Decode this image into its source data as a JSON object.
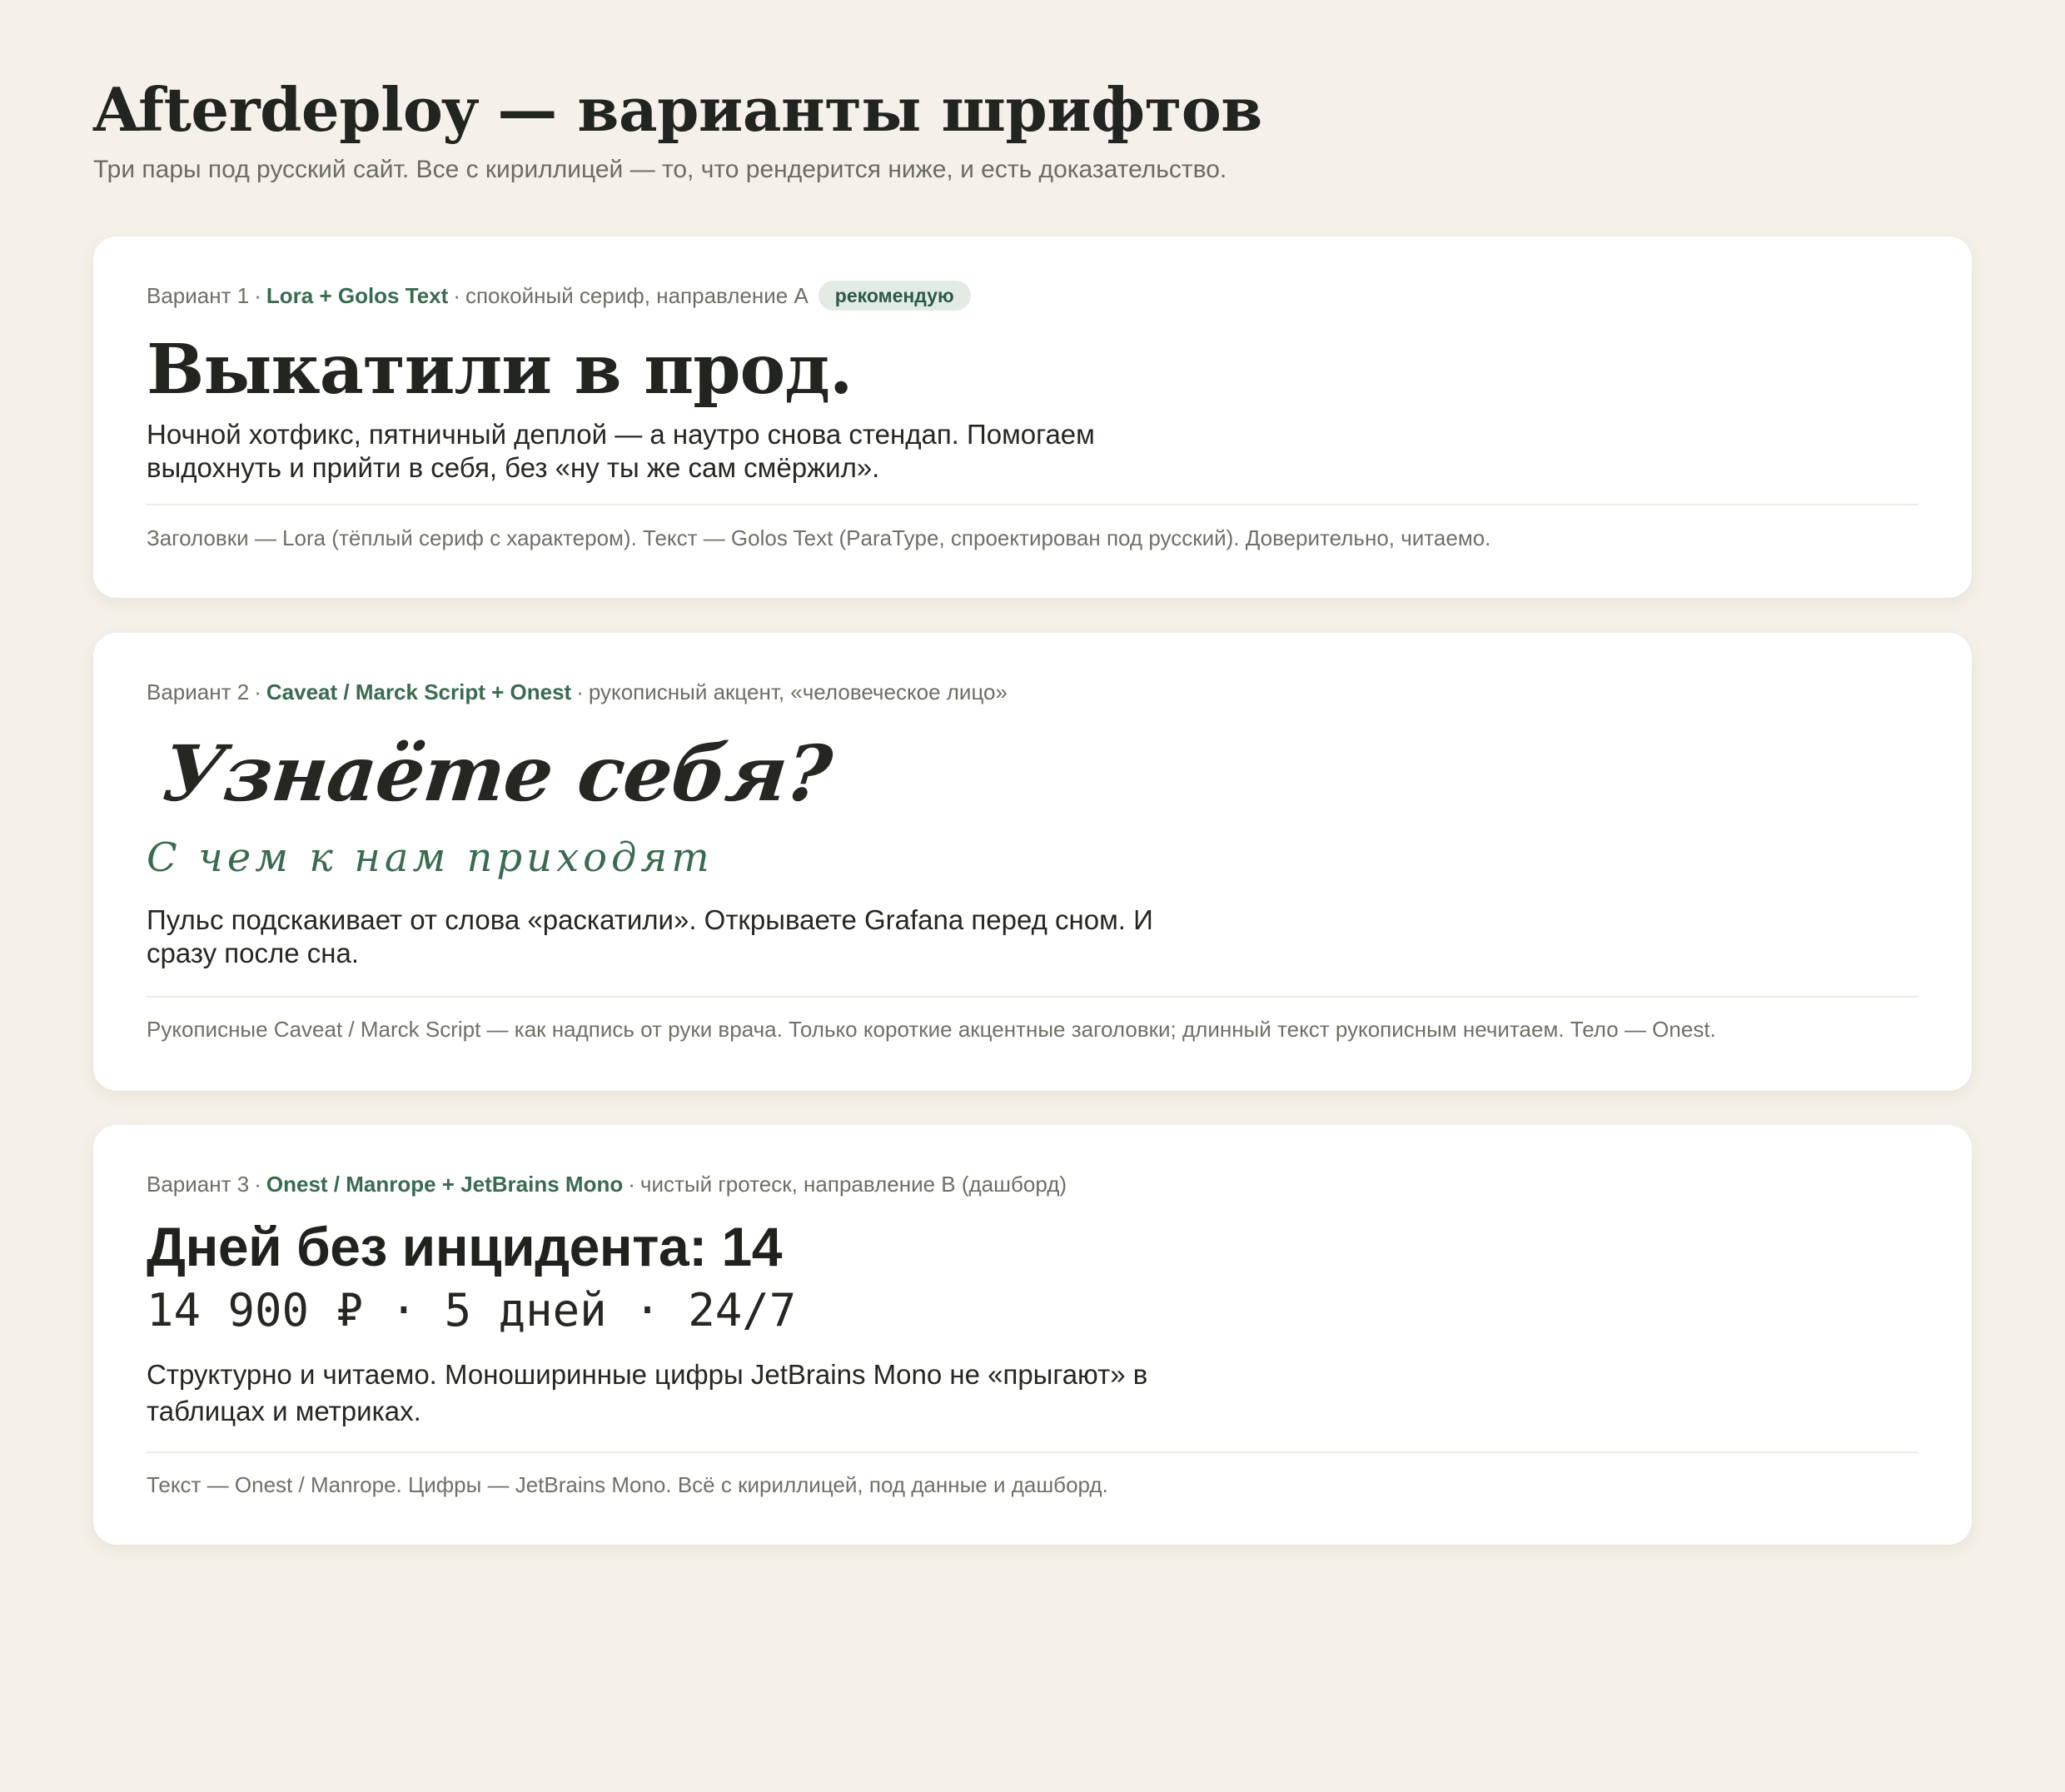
{
  "header": {
    "title": "Afterdeploy — варианты шрифтов",
    "subtitle": "Три пары под русский сайт. Все с кириллицей — то, что рендерится ниже, и есть доказательство."
  },
  "colors": {
    "page_background": "#f5f1ea",
    "card_background": "#ffffff",
    "accent_green": "#3a6b51",
    "badge_background": "#e2ece5",
    "heading_text": "#22251f",
    "muted_text": "#6e6e66"
  },
  "variants": [
    {
      "label": "Вариант 1",
      "fonts": "Lora + Golos Text",
      "description": "спокойный сериф, направление А",
      "badge": "рекомендую",
      "headline": "Выкатили в прод.",
      "body": "Ночной хотфикс, пятничный деплой — а наутро снова стендап. Помогаем выдохнуть и прийти в себя, без «ну ты же сам смёржил».",
      "note": "Заголовки — Lora (тёплый сериф с характером). Текст — Golos Text (ParaType, спроектирован под русский). Доверительно, читаемо."
    },
    {
      "label": "Вариант 2",
      "fonts": "Caveat / Marck Script + Onest",
      "description": "рукописный акцент, «человеческое лицо»",
      "headline": "Узнаёте себя?",
      "subheadline": "С чем к нам приходят",
      "body": "Пульс подскакивает от слова «раскатили». Открываете Grafana перед сном. И сразу после сна.",
      "note": "Рукописные Caveat / Marck Script — как надпись от руки врача. Только короткие акцентные заголовки; длинный текст рукописным нечитаем. Тело — Onest."
    },
    {
      "label": "Вариант 3",
      "fonts": "Onest / Manrope + JetBrains Mono",
      "description": "чистый гротеск, направление В (дашборд)",
      "headline": "Дней без инцидента: 14",
      "metrics": "14 900 ₽ · 5 дней · 24/7",
      "body": "Структурно и читаемо. Моноширинные цифры JetBrains Mono не «прыгают» в таблицах и метриках.",
      "note": "Текст — Onest / Manrope. Цифры — JetBrains Mono. Всё с кириллицей, под данные и дашборд."
    }
  ],
  "separator": "·"
}
